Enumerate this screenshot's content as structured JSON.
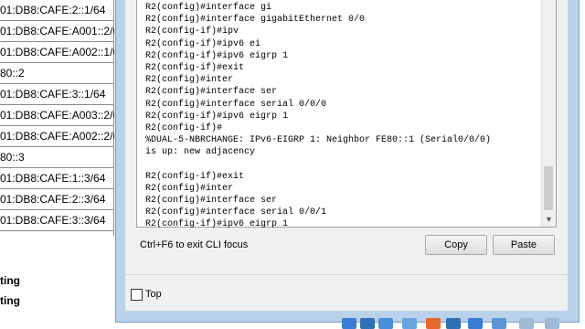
{
  "background_table": {
    "rows": [
      "01:DB8:CAFE:2::1/64",
      "01:DB8:CAFE:A001::2/6",
      "01:DB8:CAFE:A002::1/6",
      "80::2",
      "01:DB8:CAFE:3::1/64",
      "01:DB8:CAFE:A003::2/6",
      "01:DB8:CAFE:A002::2/6",
      "80::3",
      "01:DB8:CAFE:1::3/64",
      "01:DB8:CAFE:2::3/64",
      "01:DB8:CAFE:3::3/64"
    ],
    "bold_labels": [
      "ting",
      "ting"
    ]
  },
  "console": {
    "lines": [
      "R2(config)#interface gi",
      "R2(config)#interface gigabitEthernet 0/0",
      "R2(config-if)#ipv",
      "R2(config-if)#ipv6 ei",
      "R2(config-if)#ipv6 eigrp 1",
      "R2(config-if)#exit",
      "R2(config)#inter",
      "R2(config)#interface ser",
      "R2(config)#interface serial 0/0/0",
      "R2(config-if)#ipv6 eigrp 1",
      "R2(config-if)#",
      "%DUAL-5-NBRCHANGE: IPv6-EIGRP 1: Neighbor FE80::1 (Serial0/0/0)",
      "is up: new adjacency",
      "",
      "R2(config-if)#exit",
      "R2(config)#inter",
      "R2(config)#interface ser",
      "R2(config)#interface serial 0/0/1",
      "R2(config-if)#ipv6 eigrp 1"
    ]
  },
  "hint_text": "Ctrl+F6 to exit CLI focus",
  "buttons": {
    "copy": "Copy",
    "paste": "Paste"
  },
  "checkbox": {
    "label": "Top",
    "checked": false
  },
  "taskbar": {
    "icons": [
      "network-icon",
      "router-icon",
      "switch-icon",
      "lightning-icon",
      "hub-icon",
      "wireless-icon",
      "end-device-icon",
      "cloud-icon",
      "connection-icon"
    ]
  }
}
